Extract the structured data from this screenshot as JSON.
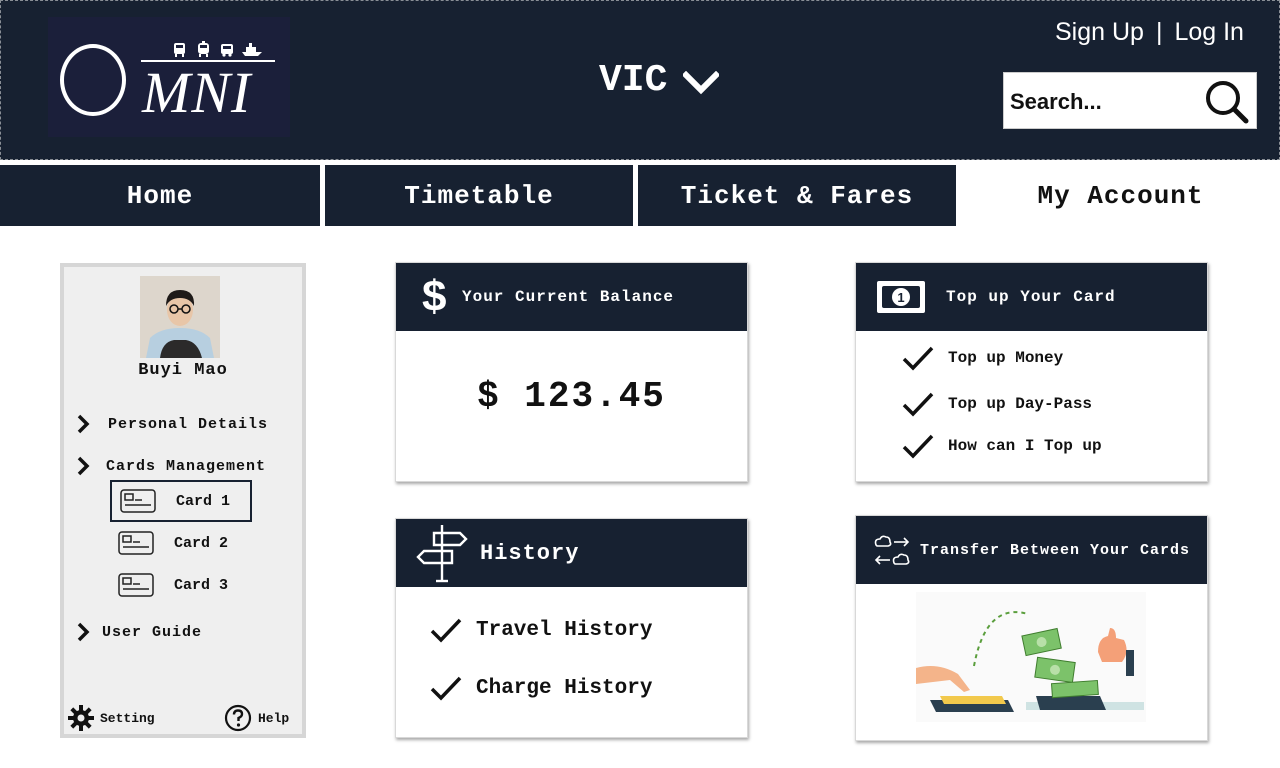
{
  "header": {
    "logo_text": "MNI",
    "region": "VIC",
    "sign_up": "Sign Up",
    "separator": "|",
    "log_in": "Log In",
    "search_placeholder": "Search..."
  },
  "nav": {
    "tabs": [
      {
        "label": "Home",
        "active": false
      },
      {
        "label": "Timetable",
        "active": false
      },
      {
        "label": "Ticket & Fares",
        "active": false
      },
      {
        "label": "My Account",
        "active": true
      }
    ]
  },
  "sidebar": {
    "user_name": "Buyi Mao",
    "personal_details": "Personal Details",
    "cards_management": "Cards Management",
    "cards": [
      {
        "label": "Card 1",
        "selected": true
      },
      {
        "label": "Card 2",
        "selected": false
      },
      {
        "label": "Card 3",
        "selected": false
      }
    ],
    "user_guide": "User Guide",
    "setting": "Setting",
    "help": "Help"
  },
  "balance": {
    "title": "Your Current Balance",
    "amount": "$ 123.45"
  },
  "topup": {
    "title": "Top up Your Card",
    "items": [
      "Top up Money",
      "Top up Day-Pass",
      "How can I Top up"
    ]
  },
  "history": {
    "title": "History",
    "items": [
      "Travel History",
      "Charge History"
    ]
  },
  "transfer": {
    "title": "Transfer Between Your Cards"
  },
  "colors": {
    "navy": "#172131",
    "panel_border": "#d8d8d8",
    "sidebar_bg": "#efefef",
    "money_green": "#7cc26a"
  }
}
